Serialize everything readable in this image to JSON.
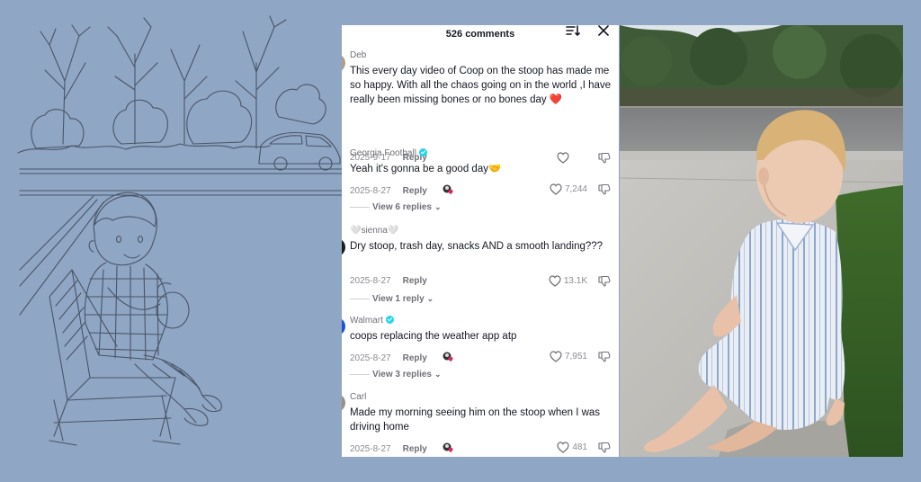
{
  "comments_panel": {
    "title": "526 comments",
    "sort_icon": "sort-icon",
    "close_icon": "close-icon",
    "comments": [
      {
        "author": "Deb",
        "verified": false,
        "text": "This every day video of Coop on the stoop has made me so happy. With all the chaos going on in the world ,I have really been missing bones or no bones day ❤️",
        "date": "2025-9-17",
        "reply_label": "Reply",
        "likes": "",
        "creator_liked": false
      },
      {
        "author": "Georgia Football",
        "verified": true,
        "text": "Yeah it's gonna be a good day🤝",
        "date": "2025-8-27",
        "reply_label": "Reply",
        "likes": "7,244",
        "creator_liked": true,
        "view_replies": "View 6 replies"
      },
      {
        "author": "🤍sienna🤍",
        "verified": false,
        "text": "Dry stoop, trash day, snacks AND a smooth landing???",
        "date": "2025-8-27",
        "reply_label": "Reply",
        "likes": "13.1K",
        "creator_liked": false,
        "view_replies": "View 1 reply"
      },
      {
        "author": "Walmart",
        "verified": true,
        "text": "coops replacing the weather app atp",
        "date": "2025-8-27",
        "reply_label": "Reply",
        "likes": "7,951",
        "creator_liked": true,
        "view_replies": "View 3 replies"
      },
      {
        "author": "Carl",
        "verified": false,
        "text": "Made my morning seeing him on the stoop when I was driving home",
        "date": "2025-8-27",
        "reply_label": "Reply",
        "likes": "481",
        "creator_liked": true
      }
    ]
  },
  "colors": {
    "background": "#8fa6c4",
    "verified_badge": "#20d5ec",
    "heart": "#e0245e"
  }
}
